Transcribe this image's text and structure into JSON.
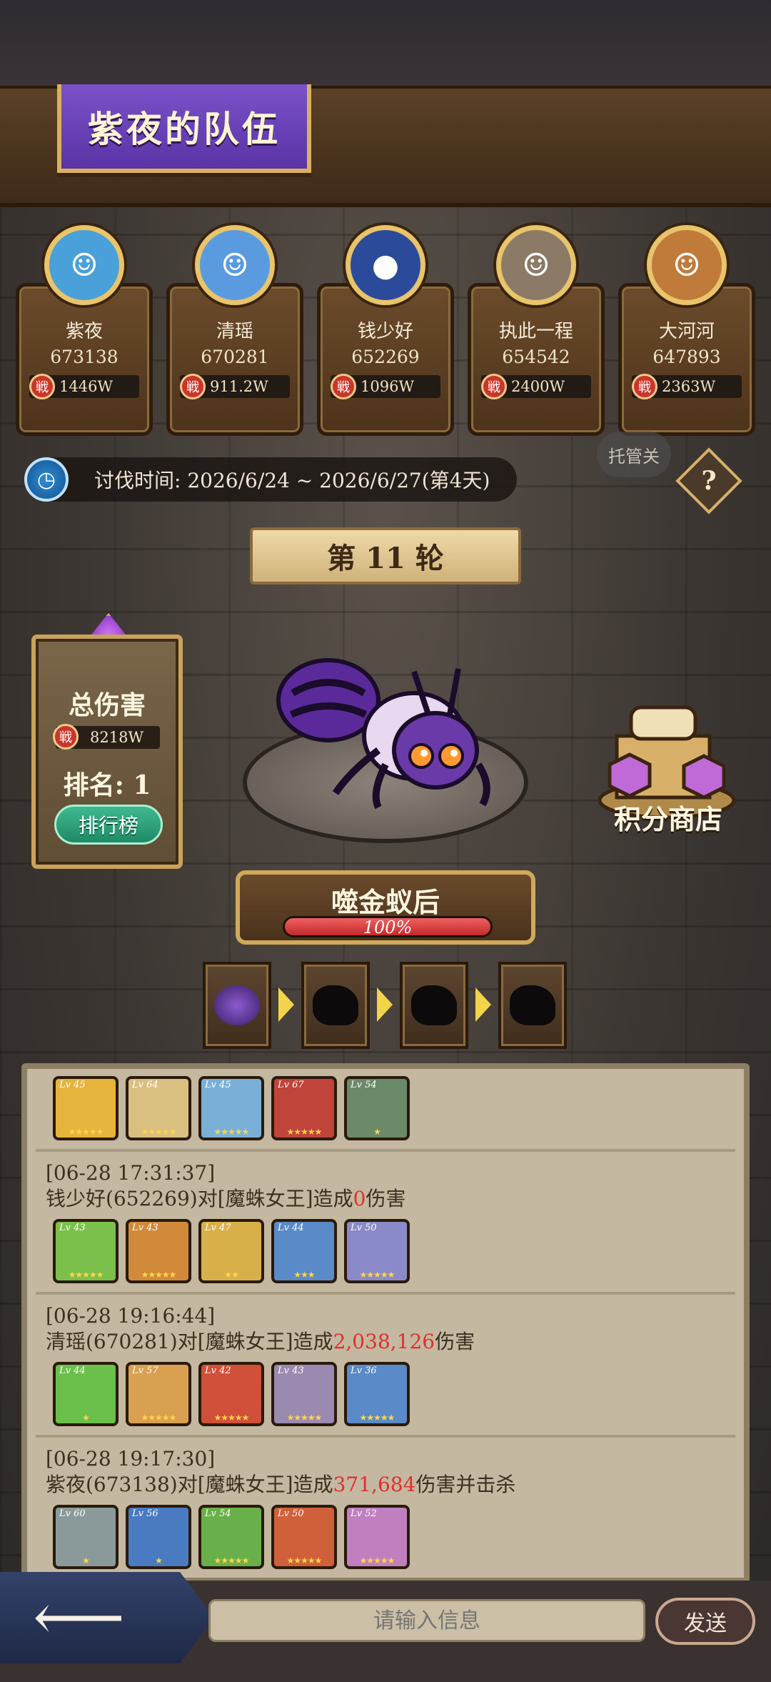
{
  "team": {
    "title": "紫夜的队伍"
  },
  "members": [
    {
      "name": "紫夜",
      "score": "673138",
      "power": "1446W",
      "avatar_color": "#4aa0d8",
      "avatar_glyph": "☺"
    },
    {
      "name": "清瑶",
      "score": "670281",
      "power": "911.2W",
      "avatar_color": "#5a9be0",
      "avatar_glyph": "☺"
    },
    {
      "name": "钱少好",
      "score": "652269",
      "power": "1096W",
      "avatar_color": "#2c4a9a",
      "avatar_glyph": "●"
    },
    {
      "name": "执此一程",
      "score": "654542",
      "power": "2400W",
      "avatar_color": "#8a7a66",
      "avatar_glyph": "☺"
    },
    {
      "name": "大河河",
      "score": "647893",
      "power": "2363W",
      "avatar_color": "#c07a3a",
      "avatar_glyph": "☺"
    }
  ],
  "time": {
    "label": "讨伐时间: 2026/6/24 ~ 2026/6/27(第4天)"
  },
  "auto_button": "托管关",
  "help_button": "?",
  "round": {
    "label": "第 11 轮"
  },
  "damage_panel": {
    "title": "总伤害",
    "value": "8218W",
    "rank": "排名: 1",
    "rank_button": "排行榜"
  },
  "shop": {
    "label": "积分商店"
  },
  "boss": {
    "name": "噬金蚁后",
    "hp_percent": 100,
    "hp_label": "100%"
  },
  "stages": [
    {
      "name": "stage-1",
      "active": true
    },
    {
      "name": "stage-2",
      "active": false
    },
    {
      "name": "stage-3",
      "active": false
    },
    {
      "name": "stage-4",
      "active": false
    }
  ],
  "logs": [
    {
      "head_pre": "",
      "damage": "",
      "head_post": "",
      "heroes": [
        {
          "lv": "Lv 45",
          "color": "#e6b43c",
          "stars": "★★★★★"
        },
        {
          "lv": "Lv 64",
          "color": "#d9c080",
          "stars": "★★★★★"
        },
        {
          "lv": "Lv 45",
          "color": "#7ab0d8",
          "stars": "★★★★★"
        },
        {
          "lv": "Lv 67",
          "color": "#c0443a",
          "stars": "★★★★★"
        },
        {
          "lv": "Lv 54",
          "color": "#6a8a6a",
          "stars": "★"
        }
      ]
    },
    {
      "time": "[06-28 17:31:37]",
      "head_pre": "钱少好(652269)对[魔蛛女王]造成",
      "damage": "0",
      "head_post": "伤害",
      "heroes": [
        {
          "lv": "Lv 43",
          "color": "#7ac04a",
          "stars": "★★★★★"
        },
        {
          "lv": "Lv 43",
          "color": "#d08a3a",
          "stars": "★★★★★"
        },
        {
          "lv": "Lv 47",
          "color": "#d8b04a",
          "stars": "★★"
        },
        {
          "lv": "Lv 44",
          "color": "#5a8ac8",
          "stars": "★★★"
        },
        {
          "lv": "Lv 50",
          "color": "#8a8ac8",
          "stars": "★★★★★"
        }
      ]
    },
    {
      "time": "[06-28 19:16:44]",
      "head_pre": "清瑶(670281)对[魔蛛女王]造成",
      "damage": "2,038,126",
      "head_post": "伤害",
      "heroes": [
        {
          "lv": "Lv 44",
          "color": "#6ac04a",
          "stars": "★"
        },
        {
          "lv": "Lv 57",
          "color": "#d8a050",
          "stars": "★★★★★"
        },
        {
          "lv": "Lv 42",
          "color": "#d0503a",
          "stars": "★★★★★"
        },
        {
          "lv": "Lv 43",
          "color": "#9a8ab0",
          "stars": "★★★★★"
        },
        {
          "lv": "Lv 36",
          "color": "#5a8ac8",
          "stars": "★★★★★"
        }
      ]
    },
    {
      "time": "[06-28 19:17:30]",
      "head_pre": "紫夜(673138)对[魔蛛女王]造成",
      "damage": "371,684",
      "head_post": "伤害并击杀",
      "heroes": [
        {
          "lv": "Lv 60",
          "color": "#8a9a9a",
          "stars": "★"
        },
        {
          "lv": "Lv 56",
          "color": "#4a7ac0",
          "stars": "★"
        },
        {
          "lv": "Lv 54",
          "color": "#6ab04a",
          "stars": "★★★★★"
        },
        {
          "lv": "Lv 50",
          "color": "#d0603a",
          "stars": "★★★★★"
        },
        {
          "lv": "Lv 52",
          "color": "#c080c0",
          "stars": "★★★★★"
        }
      ]
    }
  ],
  "chat": {
    "placeholder": "请输入信息",
    "send": "发送"
  }
}
